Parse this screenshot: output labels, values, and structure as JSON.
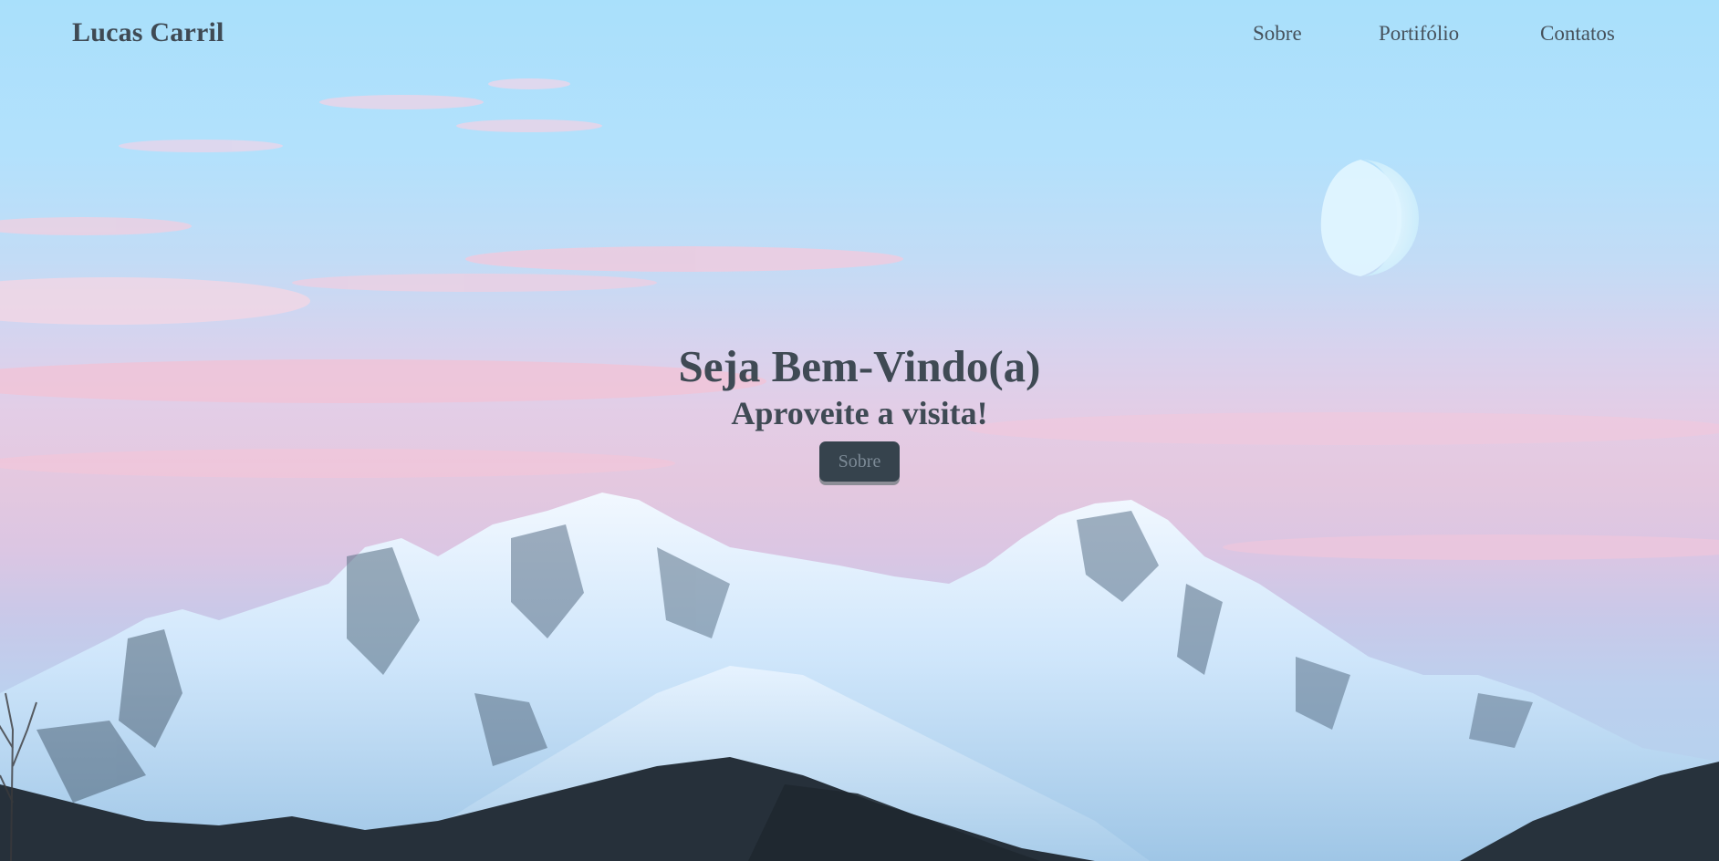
{
  "header": {
    "brand": "Lucas Carril",
    "nav": {
      "sobre": "Sobre",
      "portfolio": "Portifólio",
      "contatos": "Contatos"
    }
  },
  "hero": {
    "title": "Seja Bem-Vindo(a)",
    "subtitle": "Aproveite a visita!",
    "button_label": "Sobre"
  },
  "colors": {
    "text": "#3f4a54",
    "button_bg": "#36434d",
    "button_text": "#7c8a96",
    "sky_top": "#a9e0fb",
    "sky_pink": "#e4c8df"
  }
}
